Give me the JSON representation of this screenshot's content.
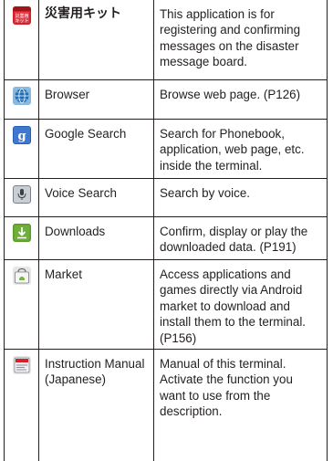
{
  "rows": [
    {
      "icon": "disaster-kit-icon",
      "name": "災害用キット",
      "desc": "This application is for registering and confirming messages on the disaster message board."
    },
    {
      "icon": "browser-globe-icon",
      "name": "Browser",
      "desc": "Browse web page. (P126)"
    },
    {
      "icon": "google-search-icon",
      "name": "Google Search",
      "desc": "Search for Phonebook, application, web page, etc. inside the terminal."
    },
    {
      "icon": "microphone-icon",
      "name": "Voice Search",
      "desc": "Search by voice."
    },
    {
      "icon": "download-icon",
      "name": "Downloads",
      "desc": "Confirm, display or play the downloaded data. (P191)"
    },
    {
      "icon": "market-bag-icon",
      "name": "Market",
      "desc": "Access applications and games directly via Android market to download and install them to the terminal. (P156)"
    },
    {
      "icon": "manual-book-icon",
      "name": "Instruction Manual (Japanese)",
      "desc": "Manual of this terminal. Activate the function you want to use from the description."
    }
  ],
  "icon_labels": {
    "disaster_kit": "災害用キット"
  },
  "colors": {
    "border": "#231f20",
    "disaster_red": "#d3222a",
    "globe_blue": "#1f6fb6",
    "google_blue": "#2b5fb3",
    "download_green": "#5a9a2a"
  }
}
